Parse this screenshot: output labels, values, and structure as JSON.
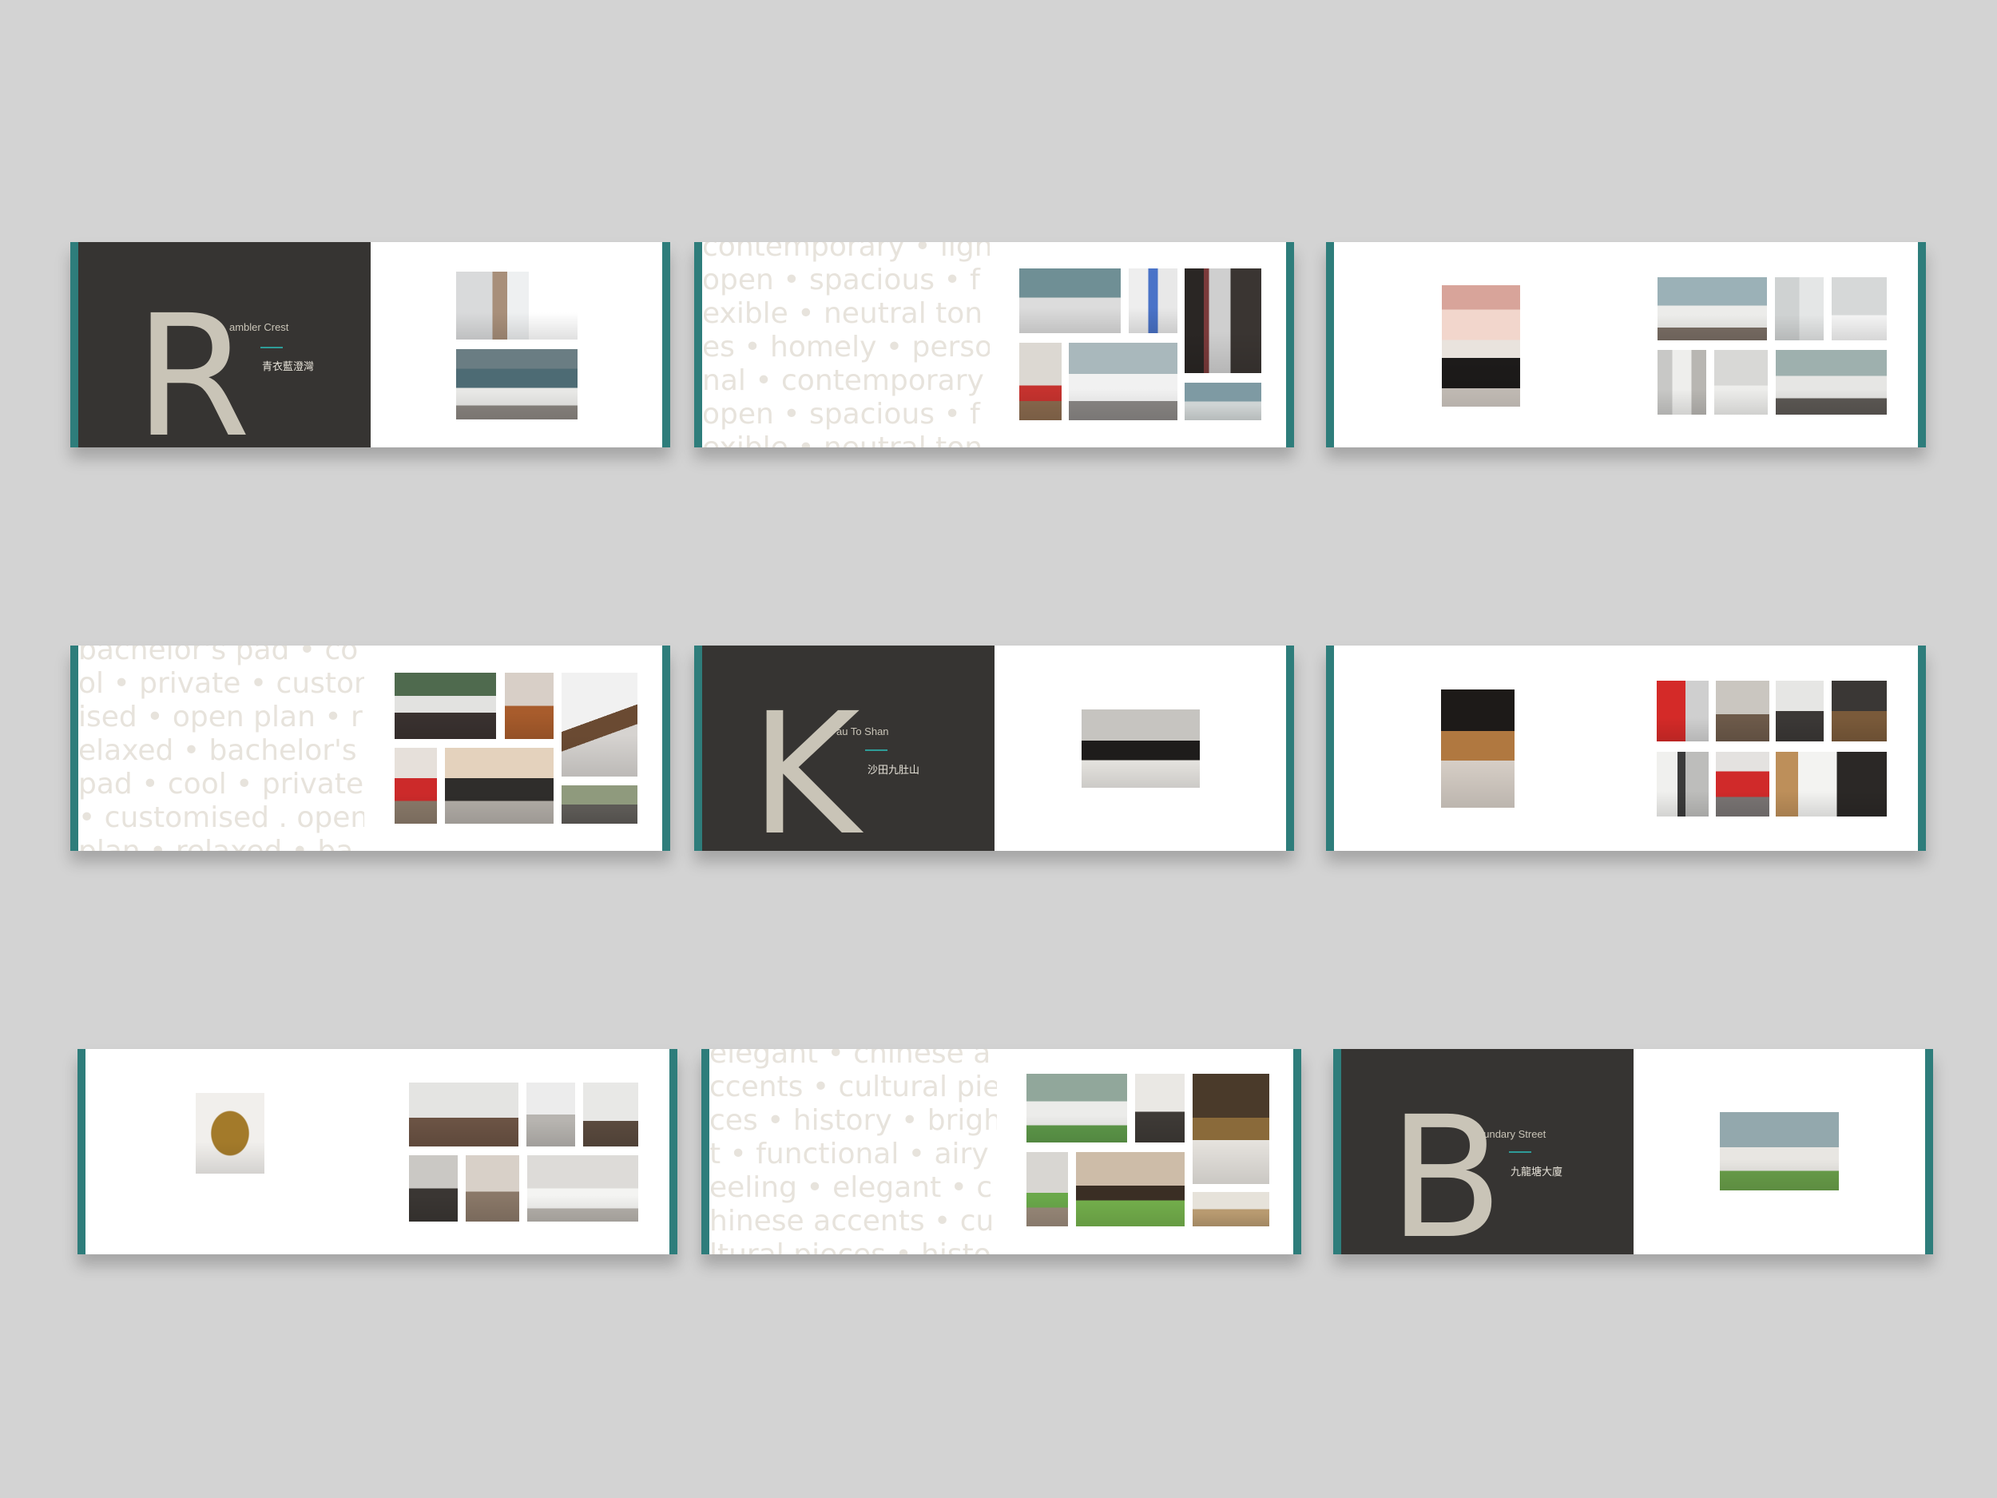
{
  "palette": {
    "background": "#d3d3d3",
    "accent_teal": "#2e7d7b",
    "dark_panel": "#363432",
    "letter_beige": "#c9c4b7",
    "keyword_text": "#e7e3dc"
  },
  "spreads": [
    {
      "id": "rambler-crest-cover",
      "type": "title",
      "letter": "R",
      "name_rest": "ambler Crest",
      "name_cn": "青衣藍澄灣"
    },
    {
      "id": "rambler-crest-keywords",
      "type": "keywords",
      "keyword_lines": [
        "contemporary • ligh",
        "open • spacious • f",
        "exible • neutral ton",
        "es • homely • perso",
        "nal • contemporary",
        "open • spacious • f",
        "exible • neutral ton"
      ]
    },
    {
      "id": "rambler-crest-gallery",
      "type": "gallery"
    },
    {
      "id": "bachelor-keywords",
      "type": "keywords",
      "keyword_lines": [
        "bachelor's pad • co",
        "ol • private • custom",
        "ised • open plan • r",
        "elaxed • bachelor's",
        "pad • cool • private",
        "• customised . open",
        "plan • relaxed • ba"
      ]
    },
    {
      "id": "kau-to-shan-cover",
      "type": "title",
      "letter": "K",
      "name_rest": "au To Shan",
      "name_cn": "沙田九肚山"
    },
    {
      "id": "kau-to-shan-gallery",
      "type": "gallery"
    },
    {
      "id": "chinese-accents-gallery",
      "type": "gallery"
    },
    {
      "id": "chinese-accents-keywords",
      "type": "keywords",
      "keyword_lines": [
        "elegant • chinese a",
        "ccents • cultural pie",
        "ces • history • brigh",
        "t • functional • airy f",
        "eeling • elegant • c",
        "hinese accents • cu",
        "ltural pieces • histo"
      ]
    },
    {
      "id": "boundary-street-cover",
      "type": "title",
      "letter": "B",
      "name_rest": "oundary Street",
      "name_cn": "九龍塘大廈"
    }
  ]
}
